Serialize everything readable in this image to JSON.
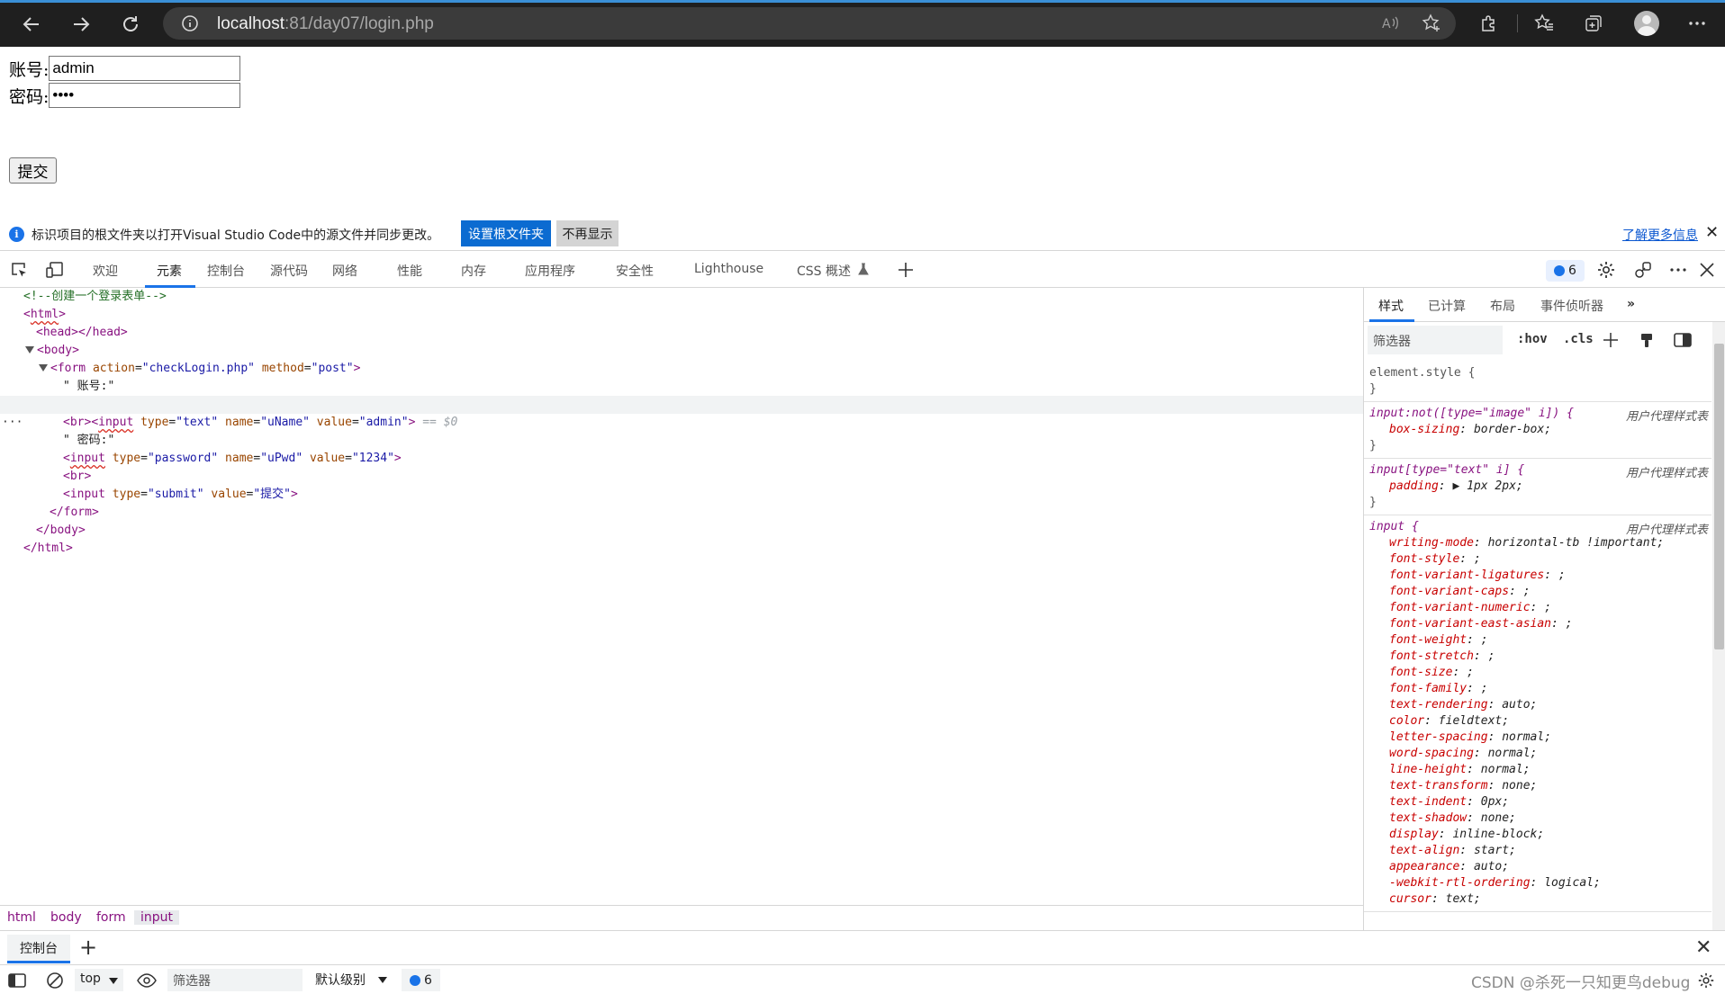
{
  "browser": {
    "url_host": "localhost",
    "url_path": ":81/day07/login.php"
  },
  "page": {
    "account_label": "账号:",
    "account_value": "admin",
    "password_label": "密码:",
    "password_value": "••••",
    "submit_label": "提交"
  },
  "infobar": {
    "message": "标识项目的根文件夹以打开Visual Studio Code中的源文件并同步更改。",
    "set_root_button": "设置根文件夹",
    "dont_show_button": "不再显示",
    "learn_more": "了解更多信息",
    "close": "✕"
  },
  "devtools": {
    "tabs": [
      "欢迎",
      "元素",
      "控制台",
      "源代码",
      "网络",
      "性能",
      "内存",
      "应用程序",
      "安全性",
      "Lighthouse",
      "CSS 概述"
    ],
    "issues_count": "6",
    "dom": {
      "l1": "<!--创建一个登录表单-->",
      "l2_open": "<",
      "l2_tag": "html",
      "l2_close": ">",
      "l3": "<head></head>",
      "l4": "<body>",
      "l5_tag": "<form",
      "l5_a1": " action",
      "l5_v1": "\"checkLogin.php\"",
      "l5_a2": " method",
      "l5_v2": "\"post\"",
      "l5_end": ">",
      "l6": "\" 账号:\"",
      "l7_open": "<",
      "l7_tag": "input",
      "l7_a1": " type",
      "l7_v1": "\"text\"",
      "l7_a2": " name",
      "l7_v2": "\"uName\"",
      "l7_a3": " value",
      "l7_v3": "\"admin\"",
      "l7_end": ">",
      "l7_ref": " == $0",
      "l8": "<br>",
      "l9": "\" 密码:\"",
      "l10_open": "<",
      "l10_tag": "input",
      "l10_a1": " type",
      "l10_v1": "\"password\"",
      "l10_a2": " name",
      "l10_v2": "\"uPwd\"",
      "l10_a3": " value",
      "l10_v3": "\"1234\"",
      "l10_end": ">",
      "l11": "<br>",
      "l12_tag": "<input",
      "l12_a1": " type",
      "l12_v1": "\"submit\"",
      "l12_a2": " value",
      "l12_v2": "\"提交\"",
      "l12_end": ">",
      "l13": "</form>",
      "l14": "</body>",
      "l15": "</html>",
      "ellipsis": "···"
    },
    "breadcrumb": [
      "html",
      "body",
      "form",
      "input"
    ],
    "styles": {
      "tabs": [
        "样式",
        "已计算",
        "布局",
        "事件侦听器"
      ],
      "filter_placeholder": "筛选器",
      "hov": ":hov",
      "cls": ".cls",
      "element_style": "element.style {",
      "rule1_sel": "input:not([type=\"image\" i]) {",
      "rule1_src": "用户代理样式表",
      "rule1_prop": "box-sizing",
      "rule1_val": "border-box;",
      "rule2_sel": "input[type=\"text\" i] {",
      "rule2_src": "用户代理样式表",
      "rule2_prop": "padding",
      "rule2_val": "▶ 1px 2px;",
      "rule3_sel": "input {",
      "rule3_src": "用户代理样式表",
      "props": [
        {
          "n": "writing-mode",
          "v": "horizontal-tb !important;"
        },
        {
          "n": "font-style",
          "v": ";"
        },
        {
          "n": "font-variant-ligatures",
          "v": ";"
        },
        {
          "n": "font-variant-caps",
          "v": ";"
        },
        {
          "n": "font-variant-numeric",
          "v": ";"
        },
        {
          "n": "font-variant-east-asian",
          "v": ";"
        },
        {
          "n": "font-weight",
          "v": ";"
        },
        {
          "n": "font-stretch",
          "v": ";"
        },
        {
          "n": "font-size",
          "v": ";"
        },
        {
          "n": "font-family",
          "v": ";"
        },
        {
          "n": "text-rendering",
          "v": "auto;"
        },
        {
          "n": "color",
          "v": "fieldtext;"
        },
        {
          "n": "letter-spacing",
          "v": "normal;"
        },
        {
          "n": "word-spacing",
          "v": "normal;"
        },
        {
          "n": "line-height",
          "v": "normal;"
        },
        {
          "n": "text-transform",
          "v": "none;"
        },
        {
          "n": "text-indent",
          "v": "0px;"
        },
        {
          "n": "text-shadow",
          "v": "none;"
        },
        {
          "n": "display",
          "v": "inline-block;"
        },
        {
          "n": "text-align",
          "v": "start;"
        },
        {
          "n": "appearance",
          "v": "auto;"
        },
        {
          "n": "-webkit-rtl-ordering",
          "v": "logical;"
        },
        {
          "n": "cursor",
          "v": "text;"
        }
      ]
    },
    "drawer": {
      "tab": "控制台",
      "top_context": "top",
      "filter_placeholder": "筛选器",
      "level": "默认级别",
      "issues_count": "6"
    }
  },
  "watermark": "CSDN @杀死一只知更鸟debug"
}
